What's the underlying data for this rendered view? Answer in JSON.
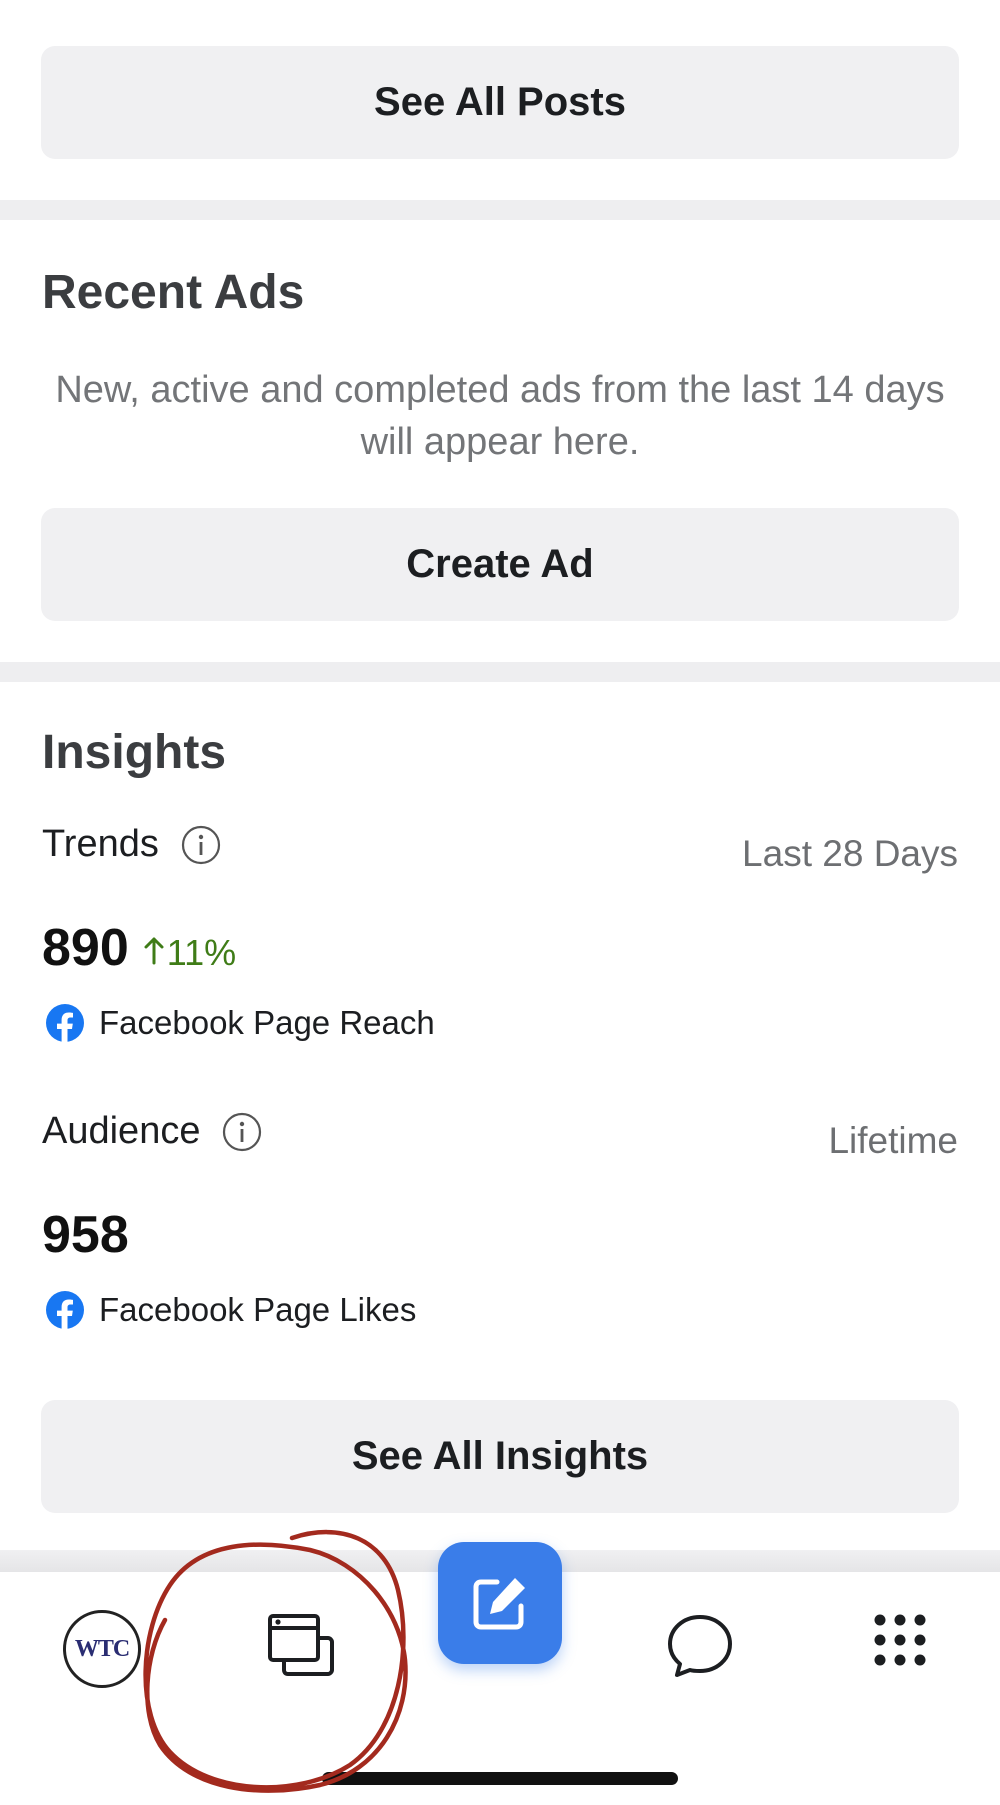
{
  "posts": {
    "see_all_label": "See All Posts"
  },
  "recent_ads": {
    "title": "Recent Ads",
    "description": "New, active and completed ads from the last 14 days will appear here.",
    "create_label": "Create Ad"
  },
  "insights": {
    "title": "Insights",
    "trends": {
      "label": "Trends",
      "period": "Last 28 Days",
      "value": "890",
      "change": "11%",
      "change_direction": "up",
      "change_color": "#3f7c17",
      "source": "Facebook Page Reach"
    },
    "audience": {
      "label": "Audience",
      "period": "Lifetime",
      "value": "958",
      "source": "Facebook Page Likes"
    },
    "see_all_label": "See All Insights"
  },
  "bottom_nav": {
    "avatar_text": "WTC",
    "items": [
      {
        "icon": "page-avatar-icon"
      },
      {
        "icon": "windows-stack-icon"
      },
      {
        "icon": "compose-icon"
      },
      {
        "icon": "chat-bubble-icon"
      },
      {
        "icon": "grid-menu-icon"
      }
    ],
    "compose_color": "#3a7de9"
  },
  "colors": {
    "facebook_blue": "#1877f2",
    "button_bg": "#f0f0f2",
    "annotation_red": "#a32a1e"
  }
}
